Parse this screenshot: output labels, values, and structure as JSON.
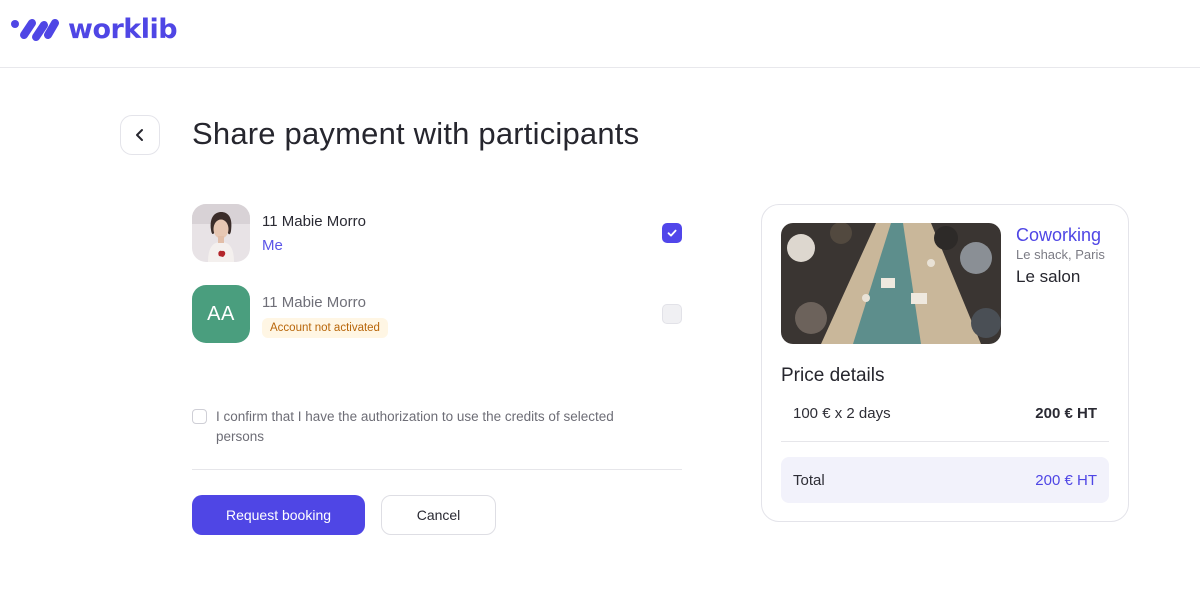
{
  "brand": {
    "name": "worklib",
    "accent": "#4f46e5"
  },
  "header": {
    "title": "Share payment with participants",
    "back_icon": "chevron-left-icon"
  },
  "participants": [
    {
      "name": "11 Mabie Morro",
      "subtitle": "Me",
      "avatar": "photo",
      "checked": true
    },
    {
      "name": "11 Mabie Morro",
      "initials": "AA",
      "badge": "Account not activated",
      "avatar_color": "#4a9e7e",
      "checked": false
    }
  ],
  "confirm": {
    "text": "I confirm that I have the authorization to use the credits of selected persons",
    "checked": false
  },
  "actions": {
    "primary_label": "Request booking",
    "secondary_label": "Cancel"
  },
  "summary": {
    "space_type": "Coworking",
    "location": "Le shack, Paris",
    "space_name": "Le salon",
    "price_title": "Price details",
    "line_label": "100 € x 2 days",
    "line_value": "200 € HT",
    "total_label": "Total",
    "total_value": "200 € HT"
  }
}
